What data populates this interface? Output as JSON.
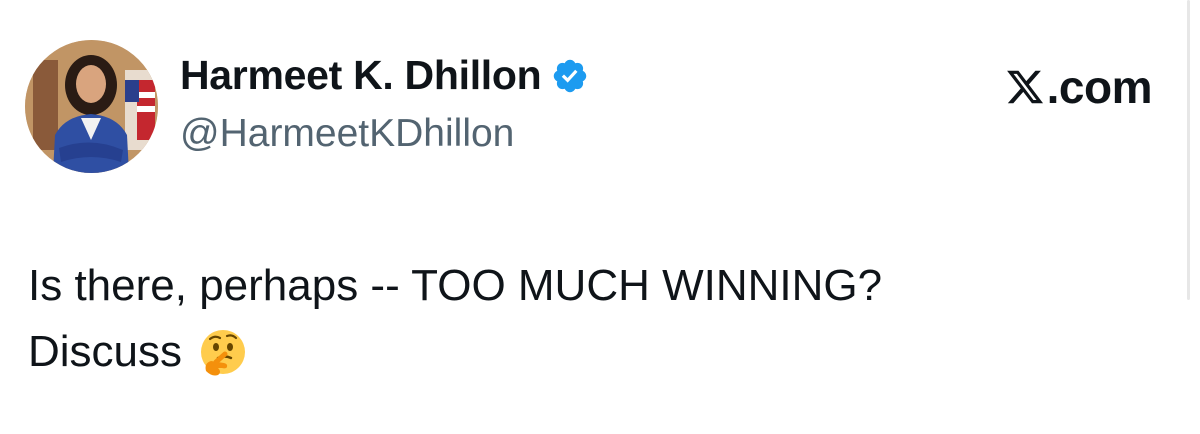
{
  "author": {
    "display_name": "Harmeet K. Dhillon",
    "handle": "@HarmeetKDhillon",
    "verified": true,
    "verified_color": "#1d9bf0"
  },
  "brand": {
    "icon": "x-logo-icon",
    "label": ".com"
  },
  "tweet": {
    "line1": "Is there, perhaps -- TOO MUCH WINNING?",
    "line2": "Discuss",
    "emoji_icon": "thinking-face-emoji"
  },
  "colors": {
    "text_primary": "#0f1419",
    "text_secondary": "#536471",
    "background": "#ffffff"
  }
}
